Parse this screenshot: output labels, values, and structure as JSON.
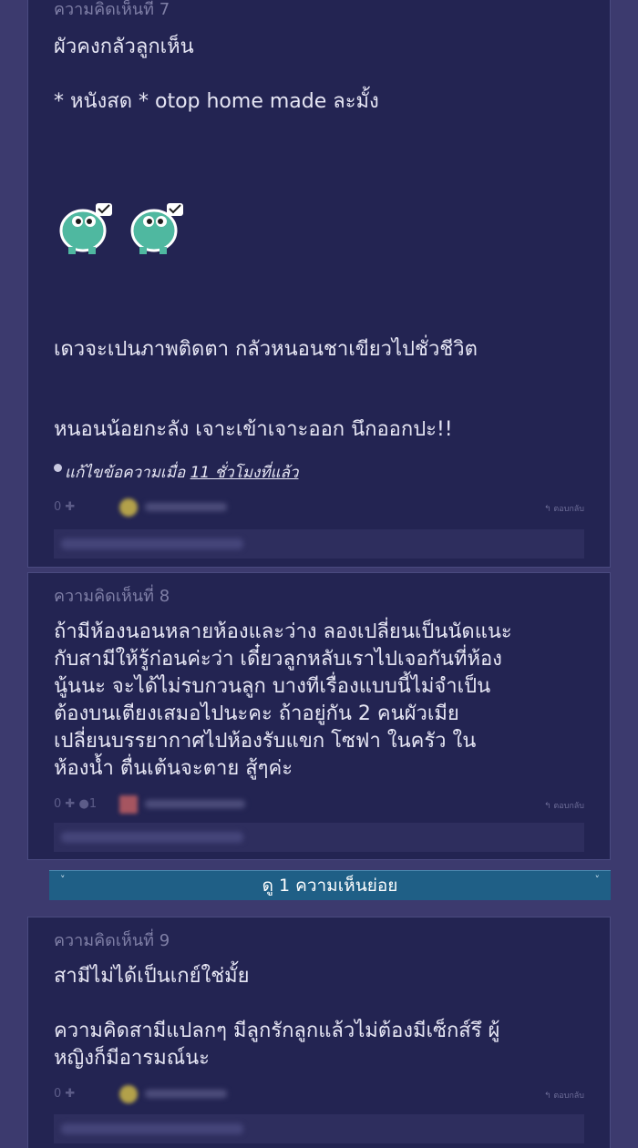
{
  "comments": [
    {
      "number_label": "ความคิดเห็นที่ 7",
      "lines": [
        "ผัวคงกลัวลูกเห็น",
        "* หนังสด * otop home made ละมั้ง",
        "เดวจะเปนภาพติดตา กลัวหนอนชาเขียวไปชั่วชีวิต",
        "หนอนน้อยกะลัง เจาะเข้าเจาะออก  นึกออกปะ!!"
      ],
      "edited_prefix": "แก้ไขข้อความเมื่อ ",
      "edited_time": "11 ชั่วโมงที่แล้ว",
      "votes": "0",
      "reply_label": "ตอบกลับ"
    },
    {
      "number_label": "ความคิดเห็นที่ 8",
      "lines": [
        "ถ้ามีห้องนอนหลายห้องและว่าง ลองเปลี่ยนเป็นนัดแนะ",
        "กับสามีให้รู้ก่อนค่ะว่า เดี๋ยวลูกหลับเราไปเจอกันที่ห้อง",
        "นู้นนะ จะได้ไม่รบกวนลูก บางทีเรื่องแบบนี้ไม่จำเป็น",
        "ต้องบนเตียงเสมอไปนะคะ ถ้าอยู่กัน 2 คนผัวเมีย",
        "เปลี่ยนบรรยากาศไปห้องรับแขก โซฟา ในครัว ใน",
        "ห้องน้ำ ตื่นเต้นจะตาย สู้ๆค่ะ"
      ],
      "votes": "0",
      "emotion_count": "1",
      "reply_label": "ตอบกลับ"
    },
    {
      "number_label": "ความคิดเห็นที่ 9",
      "lines": [
        "สามีไม่ได้เป็นเกย์ใช่มั้ย",
        "ความคิดสามีแปลกๆ มีลูกรักลูกแล้วไม่ต้องมีเซ็กส์รึ ผู้",
        "หญิงก็มีอารมณ์นะ"
      ],
      "votes": "0",
      "reply_label": "ตอบกลับ"
    }
  ],
  "sub_reply_button": {
    "label": "ดู 1 ความเห็นย่อย",
    "chevron": "˅"
  },
  "icons": [
    "sticker-icon",
    "plus-icon",
    "reply-icon",
    "avatar-icon",
    "dot-icon"
  ],
  "colors": {
    "background": "#3c3a6e",
    "card": "#232452",
    "text": "#e6e6f4",
    "muted": "#7f7fa6",
    "sub_reply_bar": "#1f5f86"
  }
}
